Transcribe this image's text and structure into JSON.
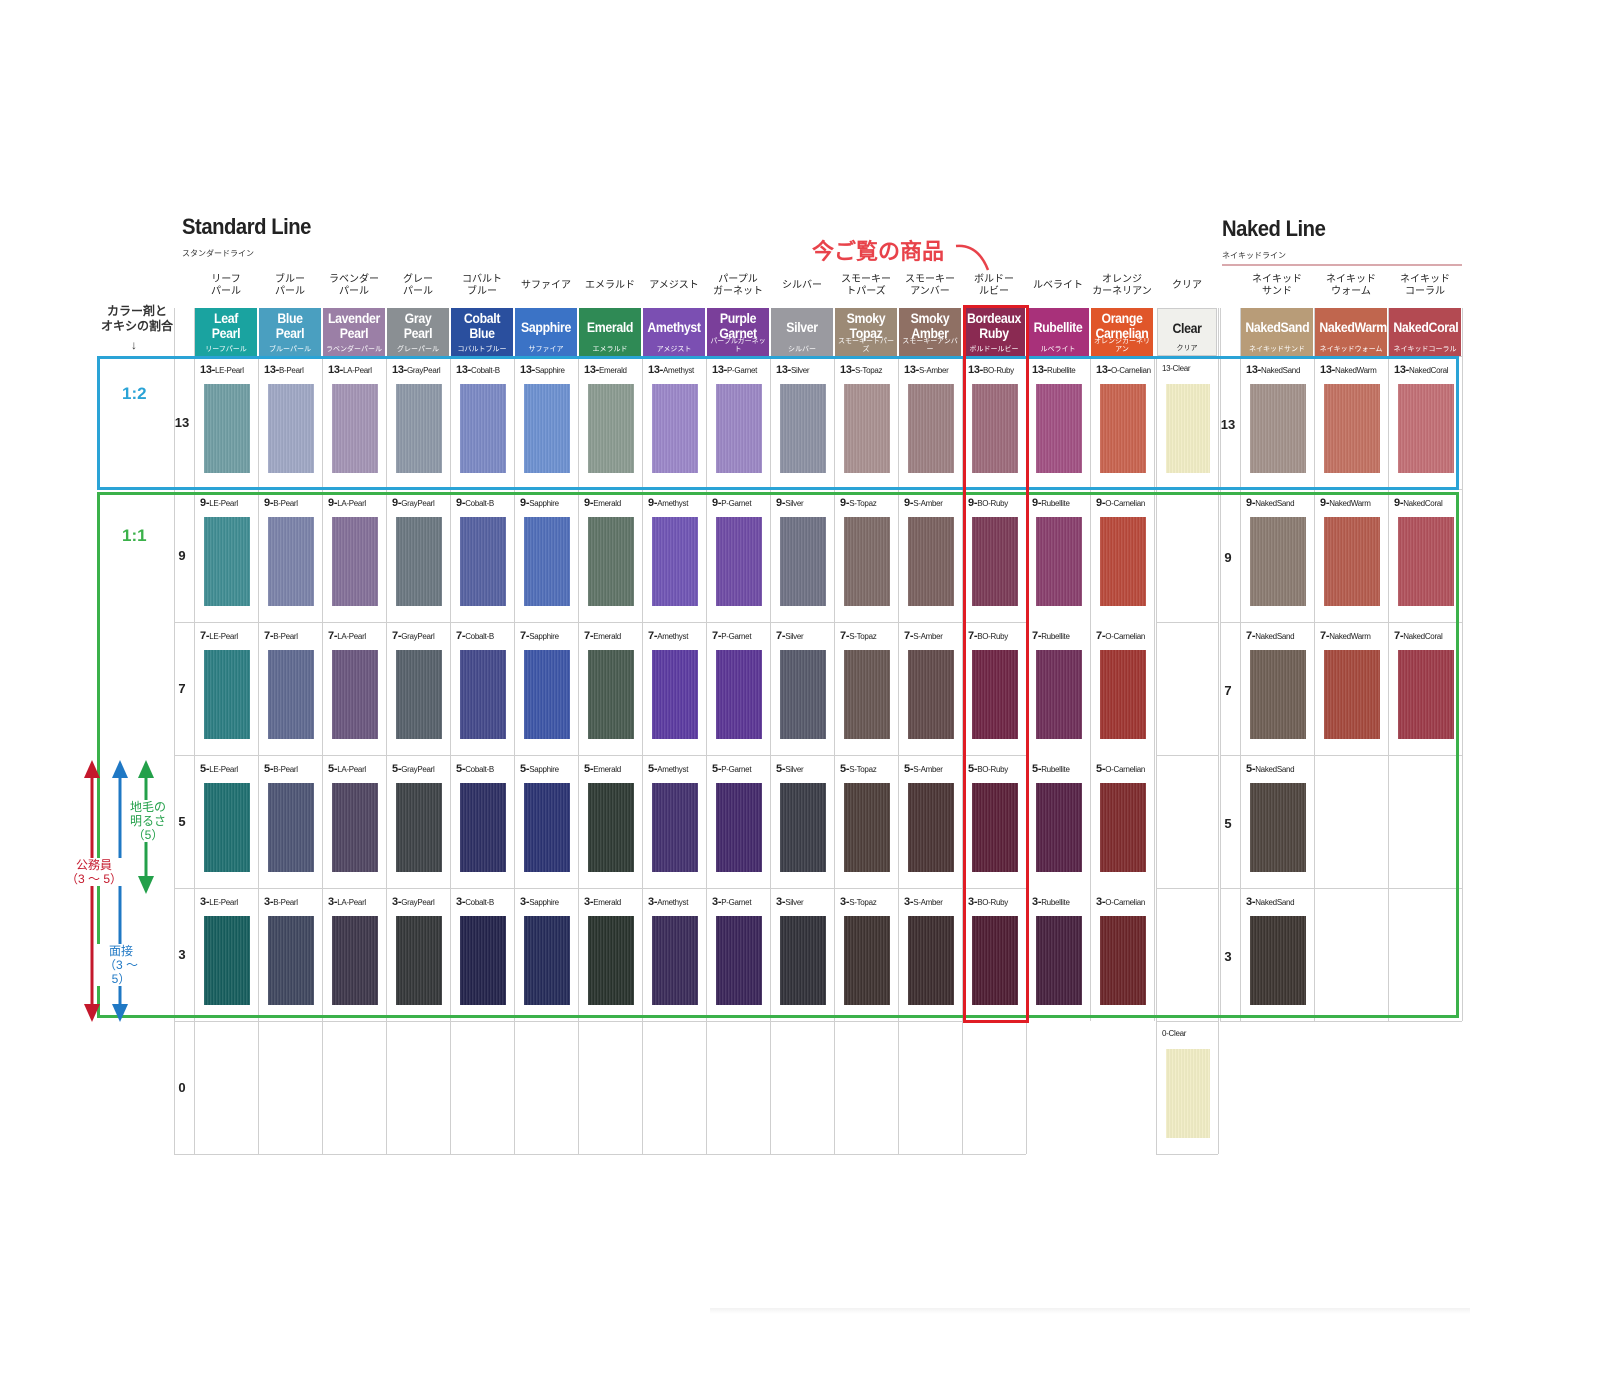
{
  "standard": {
    "title": "Standard Line",
    "subtitle": "スタンダードライン"
  },
  "naked": {
    "title": "Naked Line",
    "subtitle": "ネイキッドライン"
  },
  "ratio_header": "カラー剤と\nオキシの割合",
  "ratio_arrow": "↓",
  "ratio_12": "1:2",
  "ratio_11": "1:1",
  "now_viewing": "今ご覧の商品",
  "side": {
    "natural": "地毛の\n明るさ\n（5）",
    "civil": "公務員\n（3 ～ 5）",
    "interview": "面接\n（3 ～ 5）"
  },
  "levels": [
    "13",
    "9",
    "7",
    "5",
    "3",
    "0"
  ],
  "shades": [
    {
      "id": "LE-Pearl",
      "code": "LE-Pearl",
      "jp_header": "リーフ\nパール",
      "en": "Leaf\nPearl",
      "jp": "リーフパール",
      "color": "#1aa3a0",
      "sw": [
        "#6f9da3",
        "#3f8c92",
        "#2b7d82",
        "#1e6f70",
        "#155d5c"
      ]
    },
    {
      "id": "B-Pearl",
      "code": "B-Pearl",
      "jp_header": "ブルー\nパール",
      "en": "Blue\nPearl",
      "jp": "ブルーパール",
      "color": "#4a9fc0",
      "sw": [
        "#9ea6c4",
        "#7a82a8",
        "#5f6990",
        "#4d5574",
        "#3f465e"
      ]
    },
    {
      "id": "LA-Pearl",
      "code": "LA-Pearl",
      "jp_header": "ラベンダー\nパール",
      "en": "Lavender\nPearl",
      "jp": "ラベンダーパール",
      "color": "#9b7fa6",
      "sw": [
        "#a393b4",
        "#836f98",
        "#6a567e",
        "#4f4561",
        "#3d364a"
      ]
    },
    {
      "id": "GrayPearl",
      "code": "GrayPearl",
      "jp_header": "グレー\nパール",
      "en": "Gray\nPearl",
      "jp": "グレーパール",
      "color": "#8a8f93",
      "sw": [
        "#8c97a6",
        "#6a7680",
        "#56606a",
        "#3d4246",
        "#333638"
      ]
    },
    {
      "id": "Cobalt-B",
      "code": "Cobalt-B",
      "jp_header": "コバルト\nブルー",
      "en": "Cobalt\nBlue",
      "jp": "コバルトブルー",
      "color": "#2a4f9e",
      "sw": [
        "#7a88c4",
        "#5560a0",
        "#43488a",
        "#2c2e62",
        "#22224a"
      ]
    },
    {
      "id": "Sapphire",
      "code": "Sapphire",
      "jp_header": "サファイア",
      "en": "Sapphire",
      "jp": "サファイア",
      "color": "#3b73c6",
      "sw": [
        "#6c90d0",
        "#4f6db8",
        "#3c55a6",
        "#2a3272",
        "#242a58"
      ]
    },
    {
      "id": "Emerald",
      "code": "Emerald",
      "jp_header": "エメラルド",
      "en": "Emerald",
      "jp": "エメラルド",
      "color": "#2f8a55",
      "sw": [
        "#8a9a90",
        "#5f7366",
        "#485a4f",
        "#2e3a33",
        "#28322c"
      ]
    },
    {
      "id": "Amethyst",
      "code": "Amethyst",
      "jp_header": "アメジスト",
      "en": "Amethyst",
      "jp": "アメジスト",
      "color": "#7b4fb2",
      "sw": [
        "#9a86c8",
        "#6f54b4",
        "#5b3aa0",
        "#43306e",
        "#3a2a58"
      ]
    },
    {
      "id": "P-Garnet",
      "code": "P-Garnet",
      "jp_header": "パープル\nガーネット",
      "en": "Purple\nGarnet",
      "jp": "パープルガーネット",
      "color": "#7a3f9a",
      "sw": [
        "#9a86c4",
        "#6e4aa4",
        "#5a3494",
        "#43286a",
        "#3a2458"
      ]
    },
    {
      "id": "Silver",
      "code": "Silver",
      "jp_header": "シルバー",
      "en": "Silver",
      "jp": "シルバー",
      "color": "#9a9aa0",
      "sw": [
        "#8b90a2",
        "#6e7184",
        "#56596a",
        "#3a3c46",
        "#303038"
      ]
    },
    {
      "id": "S-Topaz",
      "code": "S-Topaz",
      "jp_header": "スモーキー\nトパーズ",
      "en": "Smoky\nTopaz",
      "jp": "スモーキートパーズ",
      "color": "#9c8a76",
      "sw": [
        "#a89090",
        "#7d6a66",
        "#665652",
        "#4d3e3a",
        "#3e3230"
      ]
    },
    {
      "id": "S-Amber",
      "code": "S-Amber",
      "jp_header": "スモーキー\nアンバー",
      "en": "Smoky\nAmber",
      "jp": "スモーキーアンバー",
      "color": "#8f7064",
      "sw": [
        "#9c7f82",
        "#79605e",
        "#614a4a",
        "#4a3434",
        "#3c2c2e"
      ]
    },
    {
      "id": "BO-Ruby",
      "code": "BO-Ruby",
      "jp_header": "ボルドー\nルビー",
      "en": "Bordeaux\nRuby",
      "jp": "ボルドールビー",
      "color": "#8a2a52",
      "sw": [
        "#9c6a7a",
        "#7a3a56",
        "#6e2444",
        "#5a1f38",
        "#4e1c32"
      ]
    },
    {
      "id": "Rubellite",
      "code": "Rubellite",
      "jp_header": "ルベライト",
      "en": "Rubellite",
      "jp": "ルベライト",
      "color": "#a8317a",
      "sw": [
        "#a04f82",
        "#883e6c",
        "#6e2e58",
        "#562246",
        "#46203e"
      ]
    },
    {
      "id": "O-Carnelian",
      "code": "O-Carnelian",
      "jp_header": "オレンジ\nカーネリアン",
      "en": "Orange\nCarnelian",
      "jp": "オレンジカーネリアン",
      "color": "#e0562a",
      "sw": [
        "#c8624e",
        "#b8483a",
        "#9e3430",
        "#7e2a2c",
        "#6a2428"
      ]
    }
  ],
  "clear": {
    "jp_header": "クリア",
    "en": "Clear",
    "jp": "クリア",
    "label_13": "13-Clear",
    "label_0": "0-Clear",
    "color": "#f0f0ec",
    "sw": "#f0ecc4"
  },
  "naked_shades": [
    {
      "id": "NakedSand",
      "code": "NakedSand",
      "jp_header": "ネイキッド\nサンド",
      "en": "NakedSand",
      "jp": "ネイキッドサンド",
      "color": "#b89c78",
      "sw": [
        "#a2918a",
        "#8a7a70",
        "#6e5e54",
        "#4e443e",
        "#3c3430"
      ]
    },
    {
      "id": "NakedWarm",
      "code": "NakedWarm",
      "jp_header": "ネイキッド\nウォーム",
      "en": "NakedWarm",
      "jp": "ネイキッドウォーム",
      "color": "#c0664e",
      "sw": [
        "#c27060",
        "#b45a4c",
        "#a4483c"
      ]
    },
    {
      "id": "NakedCoral",
      "code": "NakedCoral",
      "jp_header": "ネイキッド\nコーラル",
      "en": "NakedCoral",
      "jp": "ネイキッドコーラル",
      "color": "#b34a52",
      "sw": [
        "#c26e74",
        "#b0505a",
        "#9c3a48"
      ]
    }
  ]
}
